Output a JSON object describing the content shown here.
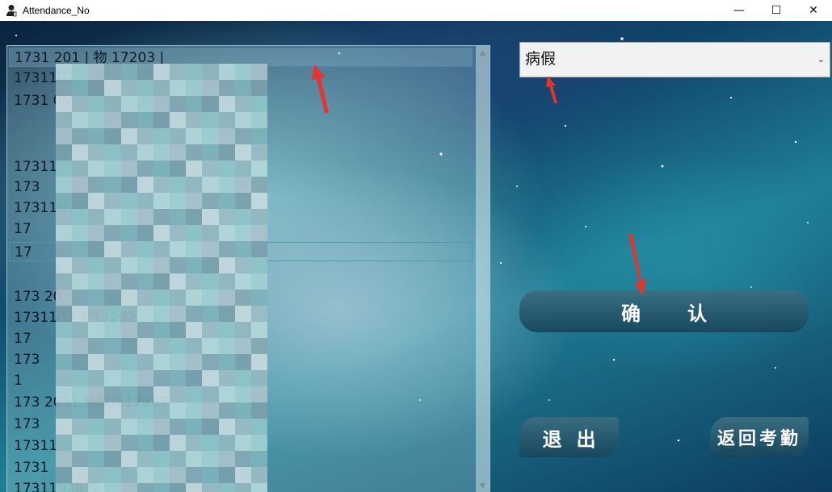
{
  "window": {
    "title": "Attendance_No",
    "icon": "person-icon",
    "controls": {
      "minimize": "—",
      "maximize": "☐",
      "close": "✕"
    }
  },
  "student_list": {
    "items": [
      "1731   201 | 物   17203 |",
      "1731102",
      "1731   05",
      "",
      "",
      "",
      "17311",
      "173",
      "173110",
      "17",
      "17",
      "",
      "",
      "173   20",
      "1731102   4     17202",
      "17",
      "173",
      "1",
      "173   2031     物联网17203",
      "173",
      "17311",
      "1731",
      "1731102032"
    ],
    "selected_index": 0,
    "focused_index": 9
  },
  "leave_type": {
    "selected": "病假",
    "arrow": "⌄"
  },
  "buttons": {
    "confirm": "确认",
    "exit": "退出",
    "back": "返回考勤"
  },
  "colors": {
    "button_fill": "#1e5870",
    "arrow_red": "#e8322a"
  }
}
